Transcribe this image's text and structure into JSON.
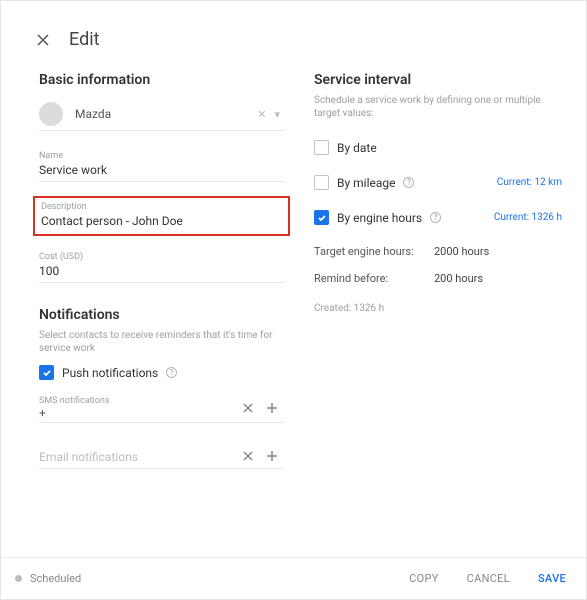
{
  "header": {
    "title": "Edit"
  },
  "basic": {
    "section_title": "Basic information",
    "vehicle": "Mazda",
    "name_label": "Name",
    "name_value": "Service work",
    "desc_label": "Description",
    "desc_value": "Contact person - John Doe",
    "cost_label": "Cost (USD)",
    "cost_value": "100"
  },
  "notifications": {
    "section_title": "Notifications",
    "subtitle": "Select contacts to receive reminders that it's time for service work",
    "push_label": "Push notifications",
    "sms_label": "SMS notifications",
    "sms_value": "+",
    "email_placeholder": "Email notifications"
  },
  "interval": {
    "section_title": "Service interval",
    "subtitle": "Schedule a service work by defining one or multiple target values:",
    "by_date": "By date",
    "by_mileage": "By mileage",
    "mileage_current": "Current: 12 km",
    "by_engine": "By engine hours",
    "engine_current": "Current: 1326 h",
    "target_label": "Target engine hours:",
    "target_value": "2000 hours",
    "remind_label": "Remind before:",
    "remind_value": "200 hours",
    "created": "Created: 1326 h"
  },
  "footer": {
    "status": "Scheduled",
    "copy": "COPY",
    "cancel": "CANCEL",
    "save": "SAVE"
  }
}
